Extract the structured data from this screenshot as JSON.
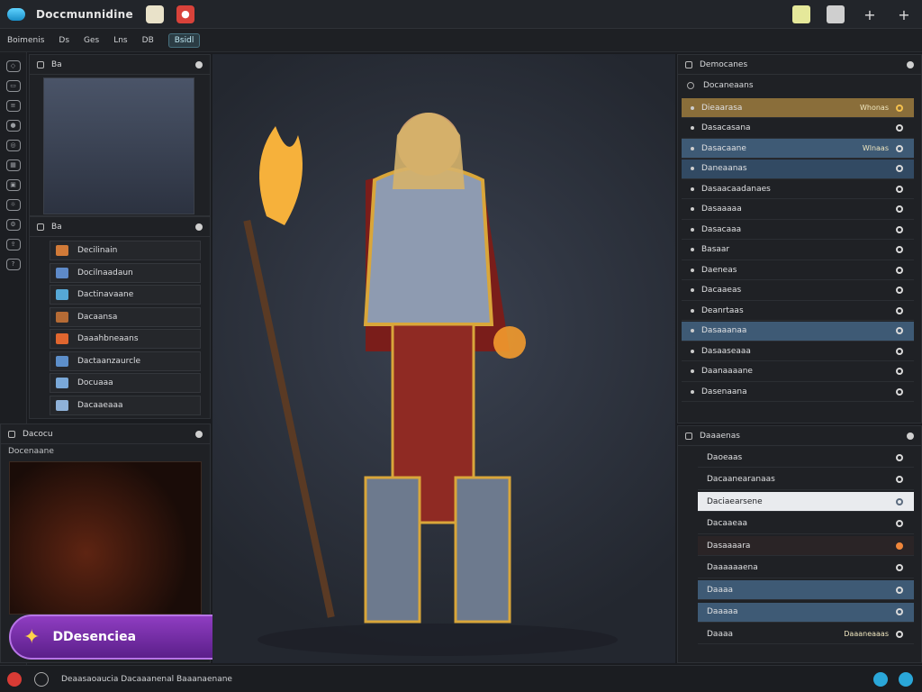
{
  "app": {
    "title": "Doccmunnidine"
  },
  "menu": [
    "Boimenis",
    "Ds",
    "Ges",
    "Lns",
    "DB",
    "Bsidl"
  ],
  "toolbar": {
    "add_label": "+",
    "expand_label": "+"
  },
  "left_preview": {
    "title": "Ba"
  },
  "assets": {
    "title": "Ba",
    "items": [
      {
        "label": "Decilinain",
        "color": "#d17a38"
      },
      {
        "label": "Docilnaadaun",
        "color": "#5e8ac8"
      },
      {
        "label": "Dactinavaane",
        "color": "#56a8d6"
      },
      {
        "label": "Dacaansa",
        "color": "#b56b35"
      },
      {
        "label": "Daaahbneaans",
        "color": "#e0662f"
      },
      {
        "label": "Dactaanzaurcle",
        "color": "#5d8fca"
      },
      {
        "label": "Docuaaa",
        "color": "#7aa8d8"
      },
      {
        "label": "Dacaaeaaa",
        "color": "#8fb2d9"
      }
    ]
  },
  "render_panel": {
    "title": "Dacocu",
    "sub": "Docenaane"
  },
  "generate_button": {
    "label": "DDesenciea"
  },
  "right_panel": {
    "title": "Democanes",
    "search": "Docaneaans",
    "rows": [
      {
        "label": "Dieaarasa",
        "tag": "Whonas",
        "highlight": "gold"
      },
      {
        "label": "Dasacasana",
        "tag": "",
        "highlight": ""
      },
      {
        "label": "Dasacaane",
        "tag": "Wlnaas",
        "highlight": "blue"
      },
      {
        "label": "Daneaanas",
        "tag": "",
        "highlight": "blue2"
      },
      {
        "label": "Dasaacaadanaes",
        "tag": "",
        "highlight": ""
      },
      {
        "label": "Dasaaaaa",
        "tag": "",
        "highlight": ""
      },
      {
        "label": "Dasacaaa",
        "tag": "",
        "highlight": ""
      },
      {
        "label": "Basaar",
        "tag": "",
        "highlight": ""
      },
      {
        "label": "Daeneas",
        "tag": "",
        "highlight": ""
      },
      {
        "label": "Dacaaeas",
        "tag": "",
        "highlight": ""
      },
      {
        "label": "Deanrtaas",
        "tag": "",
        "highlight": ""
      },
      {
        "label": "Dasaaanaa",
        "tag": "",
        "highlight": "blue"
      },
      {
        "label": "Dasaaseaaa",
        "tag": "",
        "highlight": ""
      },
      {
        "label": "Daanaaaane",
        "tag": "",
        "highlight": ""
      },
      {
        "label": "Dasenaana",
        "tag": "",
        "highlight": ""
      }
    ]
  },
  "right_panel2": {
    "title": "Daaaenas",
    "rows": [
      {
        "label": "Daoeaas",
        "highlight": ""
      },
      {
        "label": "Dacaanearanaas",
        "highlight": ""
      },
      {
        "label": "Daciaearsene",
        "highlight": "white"
      },
      {
        "label": "Dacaaeaa",
        "highlight": ""
      },
      {
        "label": "Dasaaaara",
        "highlight": "orange"
      },
      {
        "label": "Daaaaaaena",
        "highlight": ""
      },
      {
        "label": "Daaaa",
        "highlight": "blue"
      },
      {
        "label": "Daaaaa",
        "highlight": "blue"
      },
      {
        "label": "Daaaa",
        "tag": "Daaaneaaas",
        "highlight": ""
      }
    ]
  },
  "status": {
    "text": "Deaasaoaucia Dacaaanenal Baaanaenane"
  }
}
